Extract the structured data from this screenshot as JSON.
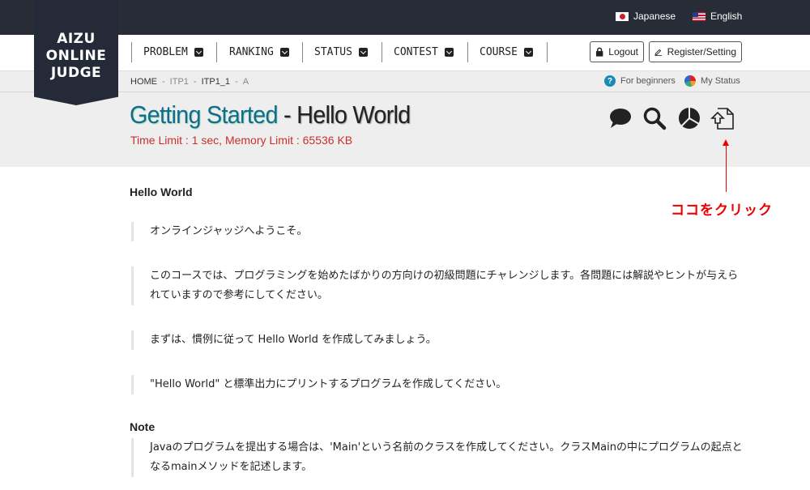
{
  "lang": {
    "japanese": "Japanese",
    "english": "English"
  },
  "logo": {
    "line1": "AIZU",
    "line2": "ONLINE",
    "line3": "JUDGE"
  },
  "nav": {
    "items": [
      {
        "label": "PROBLEM"
      },
      {
        "label": "RANKING"
      },
      {
        "label": "STATUS"
      },
      {
        "label": "CONTEST"
      },
      {
        "label": "COURSE"
      }
    ],
    "logout": "Logout",
    "register": "Register/Setting"
  },
  "breadcrumb": {
    "home": "HOME",
    "course": "ITP1",
    "topic": "ITP1_1",
    "problem": "A"
  },
  "sublinks": {
    "beginners": "For beginners",
    "status": "My Status"
  },
  "problem": {
    "title_main": "Getting Started",
    "title_sep": " - ",
    "title_sub": "Hello World",
    "limits": "Time Limit : 1 sec, Memory Limit : 65536 KB"
  },
  "annotation": {
    "text": "ココをクリック",
    "color": "#e00000"
  },
  "content": {
    "heading": "Hello World",
    "paragraphs": [
      "オンラインジャッジへようこそ。",
      "このコースでは、プログラミングを始めたばかりの方向けの初級問題にチャレンジします。各問題には解説やヒントが与えられていますので参考にしてください。",
      "まずは、慣例に従って Hello World を作成してみましょう。",
      "\"Hello World\" と標準出力にプリントするプログラムを作成してください。"
    ],
    "note_heading": "Note",
    "note": "Javaのプログラムを提出する場合は、'Main'という名前のクラスを作成してください。クラスMainの中にプログラムの起点となるmainメソッドを記述します。"
  },
  "icons": [
    "comment-icon",
    "search-icon",
    "pie-chart-icon",
    "submit-upload-icon",
    "lock-icon",
    "pencil-icon"
  ],
  "colors": {
    "topbar": "#272c37",
    "title_accent": "#156b8a",
    "limit_red": "#c9302c"
  }
}
